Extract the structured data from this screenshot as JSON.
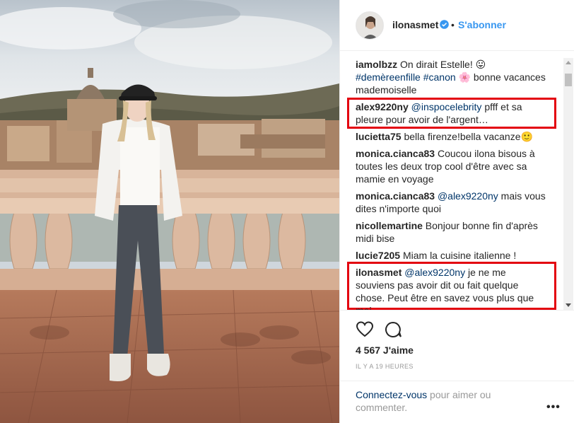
{
  "post": {
    "username": "ilonasmet",
    "follow_label": "S'abonner",
    "separator": "•",
    "verified_icon": "verified-badge-icon",
    "accent_color": "#3897f0",
    "link_color": "#003569",
    "highlight_color": "#e3000f"
  },
  "comments": [
    {
      "user": "iamolbzz",
      "text": " On dirait Estelle! 😛",
      "text2_tags": "#demèreenfille #canon",
      "text2_emoji": " 🌸",
      "text3": " bonne vacances mademoiselle"
    },
    {
      "user": "alex9220ny",
      "mention": "@inspocelebrity",
      "text": " pfff et sa pleure pour avoir de l'argent…",
      "highlighted": true
    },
    {
      "user": "lucietta75",
      "text": " bella firenze!bella vacanze🙂"
    },
    {
      "user": "monica.cianca83",
      "text": " Coucou ilona bisous à toutes les deux trop cool d'être avec sa mamie en voyage"
    },
    {
      "user": "monica.cianca83",
      "mention": "@alex9220ny",
      "text": " mais vous dites n'importe quoi"
    },
    {
      "user": "nicollemartine",
      "text": " Bonjour bonne fin d'après midi bise"
    },
    {
      "user": "lucie7205",
      "text": " Miam la cuisine italienne !"
    },
    {
      "user": "ilonasmet",
      "mention": "@alex9220ny",
      "text": " je ne me souviens pas avoir dit ou fait quelque chose. Peut être en savez vous plus que moi.",
      "highlighted": true
    }
  ],
  "actions": {
    "like_icon": "heart-icon",
    "comment_icon": "comment-bubble-icon",
    "likes": "4 567 J'aime",
    "time": "IL Y A 19 HEURES"
  },
  "login": {
    "link": "Connectez-vous",
    "rest": " pour aimer ou commenter.",
    "more_icon": "more-options-icon",
    "more_label": "•••"
  }
}
